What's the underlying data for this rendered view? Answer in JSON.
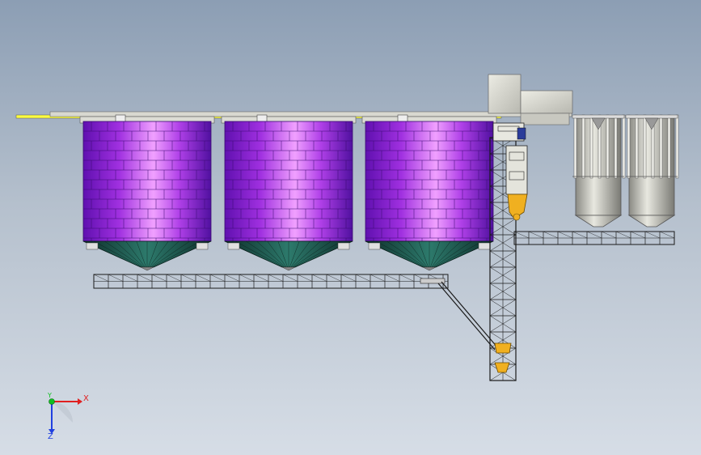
{
  "axis_triad": {
    "x_label": "X",
    "y_label": "Y",
    "z_label": "Z",
    "x_color": "#e02020",
    "y_color": "#10c020",
    "z_color": "#2040e0"
  },
  "colors": {
    "background_top": "#8c9eb4",
    "background_bottom": "#d6dde6",
    "silo_body": "#a030e0",
    "silo_highlight": "#f0a0ff",
    "hopper": "#1f5a50",
    "truss": "#1a1a1a",
    "equipment": "#f0b020",
    "steel_silo": "#c8c8c0",
    "roof_plate": "#d8d8d0",
    "beam_yellow": "#ffff40"
  }
}
